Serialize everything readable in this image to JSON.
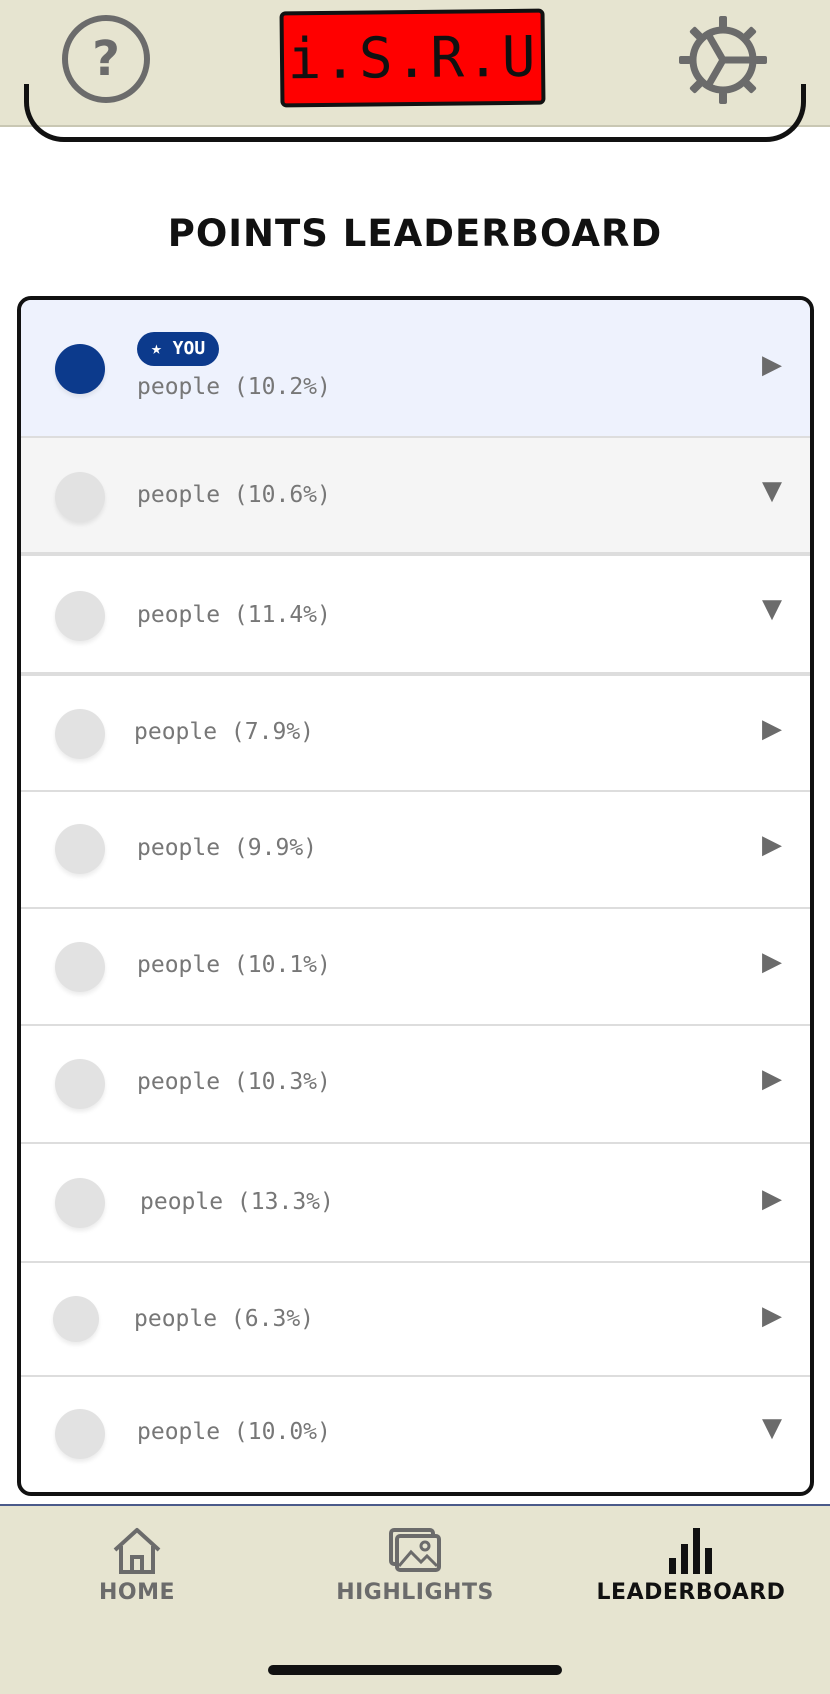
{
  "header": {
    "help_icon": "?",
    "logo_text": "i.S.R.U",
    "settings_icon": "gear-icon"
  },
  "leaderboard": {
    "title": "POINTS LEADERBOARD",
    "you_badge": "★ YOU",
    "accent_color": "#0c3a8c",
    "rows": [
      {
        "label": "people (10.2%)",
        "arrow": "▶",
        "is_you": true
      },
      {
        "label": "people (10.6%)",
        "arrow": "▼",
        "is_you": false
      },
      {
        "label": "people (11.4%)",
        "arrow": "▼",
        "is_you": false
      },
      {
        "label": "people (7.9%)",
        "arrow": "▶",
        "is_you": false
      },
      {
        "label": "people (9.9%)",
        "arrow": "▶",
        "is_you": false
      },
      {
        "label": "people (10.1%)",
        "arrow": "▶",
        "is_you": false
      },
      {
        "label": "people (10.3%)",
        "arrow": "▶",
        "is_you": false
      },
      {
        "label": "people (13.3%)",
        "arrow": "▶",
        "is_you": false
      },
      {
        "label": "people (6.3%)",
        "arrow": "▶",
        "is_you": false
      },
      {
        "label": "people (10.0%)",
        "arrow": "▼",
        "is_you": false
      }
    ]
  },
  "nav": {
    "home": "HOME",
    "highlights": "HIGHLIGHTS",
    "leaderboard": "LEADERBOARD",
    "active": "leaderboard"
  }
}
